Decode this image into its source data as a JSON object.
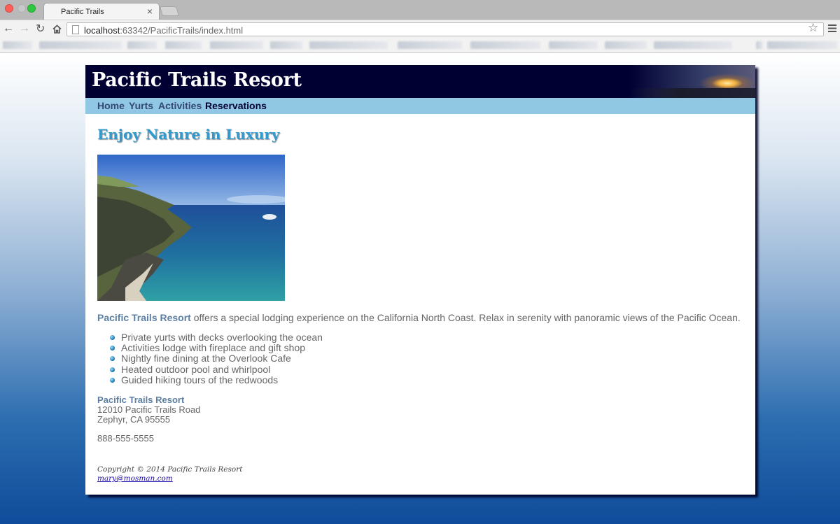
{
  "browser": {
    "tab_title": "Pacific Trails",
    "tab_close": "×",
    "url_host": "localhost",
    "url_rest": ":63342/PacificTrails/index.html"
  },
  "site": {
    "title": "Pacific Trails Resort",
    "nav": [
      "Home",
      "Yurts",
      "Activities",
      "Reservations"
    ],
    "heading": "Enjoy Nature in Luxury",
    "intro_brand": "Pacific Trails Resort",
    "intro_text": " offers a special lodging experience on the California North Coast. Relax in serenity with panoramic views of the Pacific Ocean.",
    "features": [
      "Private yurts with decks overlooking the ocean",
      "Activities lodge with fireplace and gift shop",
      "Nightly fine dining at the Overlook Cafe",
      "Heated outdoor pool and whirlpool",
      "Guided hiking tours of the redwoods"
    ],
    "contact": {
      "name": "Pacific Trails Resort",
      "street": "12010 Pacific Trails Road",
      "city": "Zephyr, CA 95555",
      "phone": "888-555-5555"
    },
    "footer": {
      "copyright": "Copyright © 2014 Pacific Trails Resort",
      "email": "mary@mosman.com"
    }
  }
}
